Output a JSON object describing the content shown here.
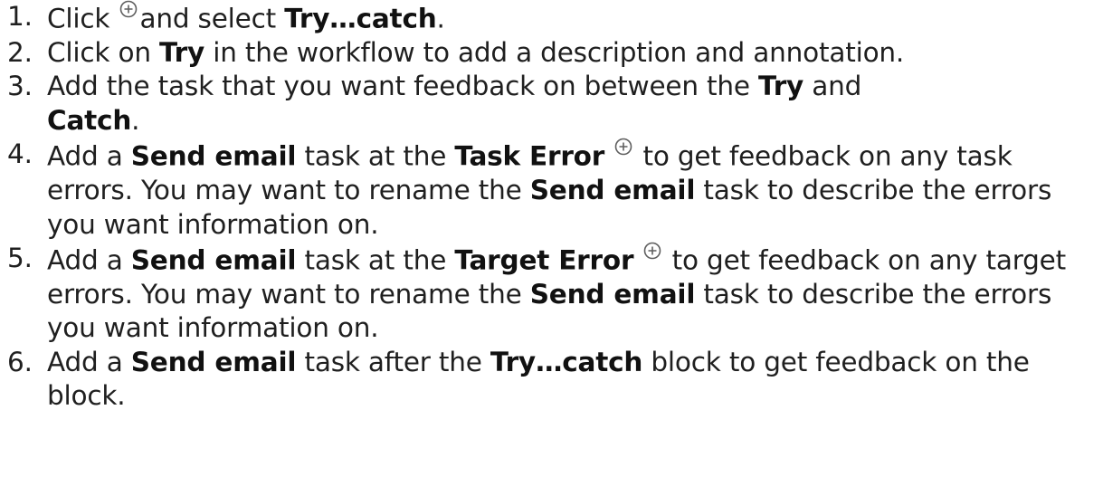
{
  "steps": [
    {
      "num": "1.",
      "parts": [
        "Click ",
        "and select ",
        "Try…catch",
        "."
      ]
    },
    {
      "num": "2.",
      "parts": [
        "Click on ",
        "Try",
        " in the workflow to add a description and annotation."
      ]
    },
    {
      "num": "3.",
      "parts": [
        "Add the task that you want feedback on between the ",
        "Try",
        " and ",
        "Catch",
        "."
      ]
    },
    {
      "num": "4.",
      "parts": [
        "Add a ",
        "Send email",
        " task at the ",
        "Task Error",
        " to get feedback on any task errors. You may want to rename the ",
        "Send email",
        " task to describe the errors you want information on."
      ]
    },
    {
      "num": "5.",
      "parts": [
        "Add a ",
        "Send email",
        " task at the ",
        "Target Error",
        " to get feedback on any target errors. You may want to rename the ",
        "Send email",
        " task to describe the errors you want information on."
      ]
    },
    {
      "num": "6.",
      "parts": [
        "Add a ",
        "Send email",
        " task after the ",
        "Try…catch",
        " block to get feedback on the block."
      ]
    }
  ],
  "icons": {
    "add": "plus-circle-icon"
  }
}
